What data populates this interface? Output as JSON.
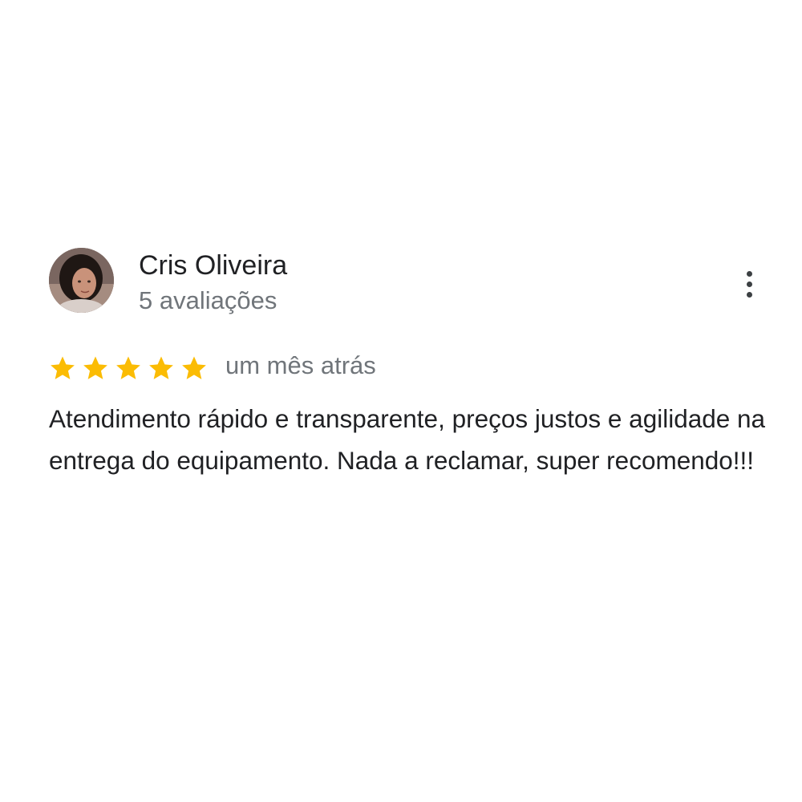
{
  "review": {
    "author": {
      "name": "Cris Oliveira",
      "review_count": "5 avaliações",
      "avatar_icon": "user-photo"
    },
    "rating": 5,
    "rating_max": 5,
    "star_color": "#fbbc04",
    "date": "um mês atrás",
    "text": "Atendimento rápido e transparente, preços justos e agilidade na entrega do equipamento. Nada a reclamar, super recomendo!!!",
    "more_icon": "more-vertical-icon"
  }
}
